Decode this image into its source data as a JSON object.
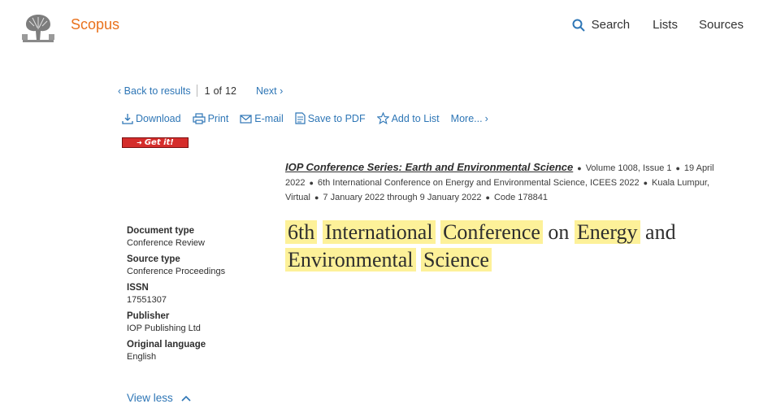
{
  "header": {
    "brand": "Scopus",
    "nav": {
      "search": "Search",
      "lists": "Lists",
      "sources": "Sources"
    }
  },
  "results_nav": {
    "back": "Back to results",
    "current": "1",
    "of": "of",
    "total": "12",
    "next": "Next"
  },
  "toolbar": {
    "download": "Download",
    "print": "Print",
    "email": "E-mail",
    "save_pdf": "Save to PDF",
    "add_list": "Add to List",
    "more": "More..."
  },
  "getit": {
    "label": "Get it!"
  },
  "source": {
    "journal": "IOP Conference Series: Earth and Environmental Science",
    "volume": "Volume 1008, Issue 1",
    "date": "19 April 2022",
    "conference": "6th International Conference on Energy and Environmental Science, ICEES 2022",
    "location": "Kuala Lumpur, Virtual",
    "dates": "7 January 2022 through 9 January 2022",
    "code": "Code 178841"
  },
  "title": {
    "words": [
      {
        "text": "6th",
        "hl": true
      },
      {
        "text": "International",
        "hl": true
      },
      {
        "text": "Conference",
        "hl": true
      },
      {
        "text": "on",
        "hl": false
      },
      {
        "text": "Energy",
        "hl": true
      },
      {
        "text": "and",
        "hl": false
      },
      {
        "text": "Environmental",
        "hl": true
      },
      {
        "text": "Science",
        "hl": true
      }
    ]
  },
  "metadata": {
    "doc_type_label": "Document type",
    "doc_type": "Conference Review",
    "source_type_label": "Source type",
    "source_type": "Conference Proceedings",
    "issn_label": "ISSN",
    "issn": "17551307",
    "publisher_label": "Publisher",
    "publisher": "IOP Publishing Ltd",
    "language_label": "Original language",
    "language": "English",
    "view_less": "View less"
  },
  "colors": {
    "brand": "#e9711c",
    "link": "#2e76b6",
    "highlight": "#fdf199",
    "getit": "#d52d2b"
  }
}
